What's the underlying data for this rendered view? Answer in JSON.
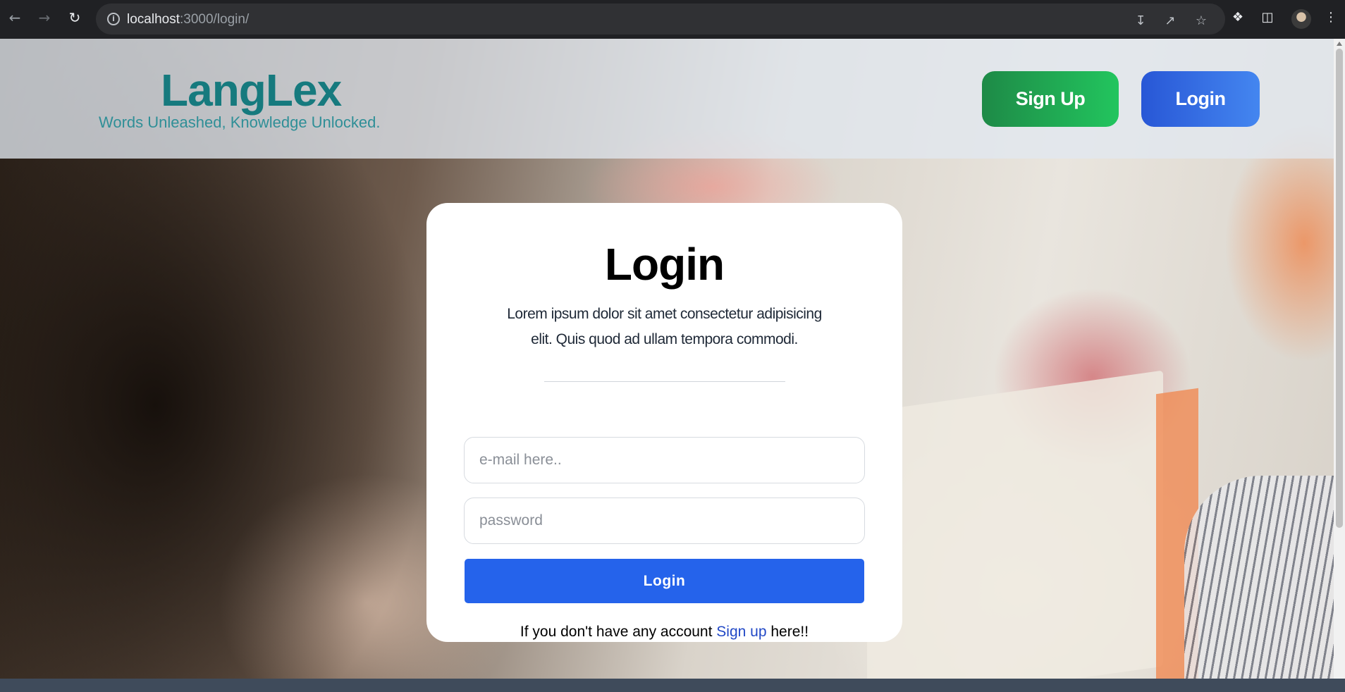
{
  "browser": {
    "url_host": "localhost",
    "url_path": ":3000/login/",
    "icons": [
      "back-arrow-icon",
      "forward-arrow-icon",
      "reload-icon",
      "site-info-icon",
      "install-app-icon",
      "share-icon",
      "bookmark-star-icon",
      "extensions-puzzle-icon",
      "side-panel-icon",
      "profile-avatar",
      "more-menu-icon"
    ]
  },
  "header": {
    "brand": "LangLex",
    "tagline": "Words Unleashed, Knowledge Unlocked.",
    "signup_label": "Sign Up",
    "login_label": "Login"
  },
  "login_card": {
    "title": "Login",
    "description": "Lorem ipsum dolor sit amet consectetur adipisicing elit. Quis quod ad ullam tempora commodi.",
    "email_placeholder": "e-mail here..",
    "email_value": "",
    "password_placeholder": "password",
    "password_value": "",
    "submit_label": "Login",
    "signup_prompt_before": "If you don't have any account ",
    "signup_link": "Sign up",
    "signup_prompt_after": " here!!"
  },
  "colors": {
    "brand_teal": "#167a7e",
    "signup_green": "#22c55e",
    "login_blue": "#2563eb",
    "link_blue": "#2148c6"
  }
}
